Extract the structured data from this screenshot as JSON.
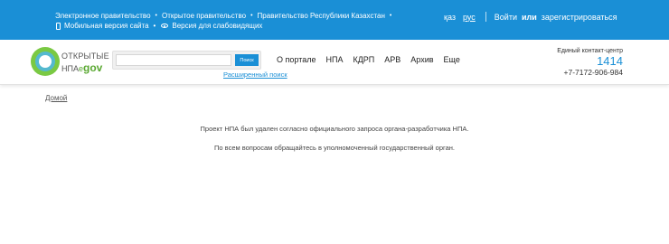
{
  "topbar": {
    "gov_links": [
      "Электронное правительство",
      "Открытое правительство",
      "Правительство Республики Казахстан"
    ],
    "mobile_version": "Мобильная версия сайта",
    "accessible_version": "Версия для слабовидящих",
    "lang_kz": "қаз",
    "lang_ru": "рус",
    "login": "Войти",
    "or": "или",
    "register": "зарегистрироваться"
  },
  "logo": {
    "line1": "ОТКРЫТЫЕ",
    "line2a": "НПА",
    "line2b": "e",
    "line2c": "gov"
  },
  "search": {
    "value": "",
    "button": "Поиск",
    "advanced": "Расширенный поиск"
  },
  "nav": [
    "О портале",
    "НПА",
    "КДРП",
    "АРВ",
    "Архив",
    "Еще"
  ],
  "contact": {
    "label": "Единый контакт-центр",
    "short_number": "1414",
    "phone": "+7-7172-906-984"
  },
  "breadcrumb": "Домой",
  "message": {
    "line1": "Проект НПА был удален согласно официального запроса органа-разработчика НПА.",
    "line2": "По всем вопросам обращайтесь в уполномоченный государственный орган."
  },
  "colors": {
    "accent": "#1a8fd6",
    "logo_green": "#7ac943"
  }
}
